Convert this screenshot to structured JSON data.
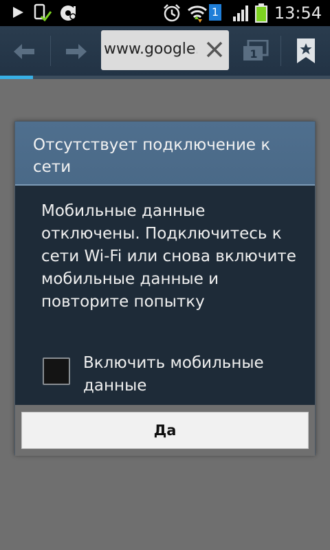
{
  "status_bar": {
    "time": "13:54",
    "icons": [
      "play-icon",
      "phone-check-icon",
      "media-icon",
      "alarm-icon",
      "wifi-icon",
      "sim-1-icon",
      "signal-icon",
      "battery-icon"
    ],
    "sim_badge": "1"
  },
  "toolbar": {
    "back_icon": "arrow-left-icon",
    "forward_icon": "arrow-right-icon",
    "url": "www.google.",
    "clear_icon": "close-icon",
    "tabs_count": "1",
    "bookmark_icon": "bookmark-star-icon",
    "load_progress": 0.1
  },
  "dialog": {
    "title": "Отсутствует подключение к сети",
    "message": "Мобильные данные отключены. Подключитесь к сети Wi-Fi или снова включите мобильные данные и повторите попытку",
    "checkbox_label": "Включить мобильные данные",
    "checkbox_checked": false,
    "ok_label": "Да"
  },
  "colors": {
    "toolbar_bg": "#24364a",
    "dialog_header": "#4c6c8a",
    "dialog_body": "#1e2b38",
    "progress_accent": "#38b0e6",
    "battery_green": "#7dd321"
  }
}
